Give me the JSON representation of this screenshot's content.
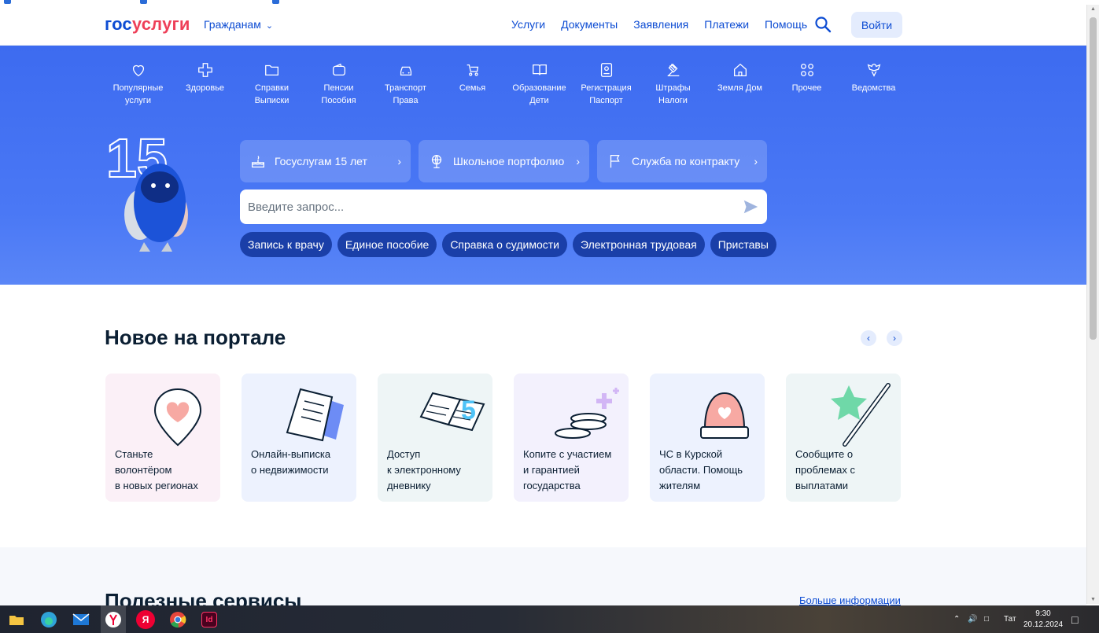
{
  "header": {
    "logo_a": "гос",
    "logo_b": "услуги",
    "audience": "Гражданам",
    "nav": [
      "Услуги",
      "Документы",
      "Заявления",
      "Платежи",
      "Помощь"
    ],
    "login": "Войти"
  },
  "categories": [
    {
      "label": "Популярные\nуслуги",
      "icon": "heart-icon"
    },
    {
      "label": "Здоровье",
      "icon": "cross-icon"
    },
    {
      "label": "Справки\nВыписки",
      "icon": "folder-icon"
    },
    {
      "label": "Пенсии\nПособия",
      "icon": "wallet-icon"
    },
    {
      "label": "Транспорт\nПрава",
      "icon": "car-icon"
    },
    {
      "label": "Семья",
      "icon": "stroller-icon"
    },
    {
      "label": "Образование\nДети",
      "icon": "book-icon"
    },
    {
      "label": "Регистрация\nПаспорт",
      "icon": "passport-icon"
    },
    {
      "label": "Штрафы\nНалоги",
      "icon": "gavel-icon"
    },
    {
      "label": "Земля Дом",
      "icon": "house-icon"
    },
    {
      "label": "Прочее",
      "icon": "grid-icon"
    },
    {
      "label": "Ведомства",
      "icon": "emblem-icon"
    }
  ],
  "promo": [
    {
      "label": "Госуслугам 15 лет",
      "icon": "cake-icon"
    },
    {
      "label": "Школьное портфолио",
      "icon": "globe-icon"
    },
    {
      "label": "Служба по контракту",
      "icon": "flag-icon"
    }
  ],
  "search": {
    "placeholder": "Введите запрос..."
  },
  "chips": [
    "Запись к врачу",
    "Единое пособие",
    "Справка о судимости",
    "Электронная трудовая",
    "Приставы"
  ],
  "mascot_badge": "15",
  "new_section": {
    "title": "Новое на портале",
    "cards": [
      {
        "text": "Станьте\nволонтёром\nв новых регионах"
      },
      {
        "text": "Онлайн-выписка\nо недвижимости"
      },
      {
        "text": "Доступ\nк электронному\nдневнику"
      },
      {
        "text": "Копите с участием\nи гарантией\nгосударства"
      },
      {
        "text": "ЧС в Курской\nобласти. Помощь\nжителям"
      },
      {
        "text": "Сообщите о\nпроблемах с\nвыплатами"
      }
    ]
  },
  "useful": {
    "title": "Полезные сервисы",
    "more": "Больше информации"
  },
  "taskbar": {
    "lang": "Тат",
    "time": "9:30",
    "date": "20.12.2024",
    "yandex_letter": "Я",
    "indesign_label": "Id"
  },
  "colors": {
    "brand_blue": "#0d4cd3",
    "brand_red": "#ee3f58",
    "hero": "#3d6bf0",
    "chip": "#1a3fa8"
  }
}
